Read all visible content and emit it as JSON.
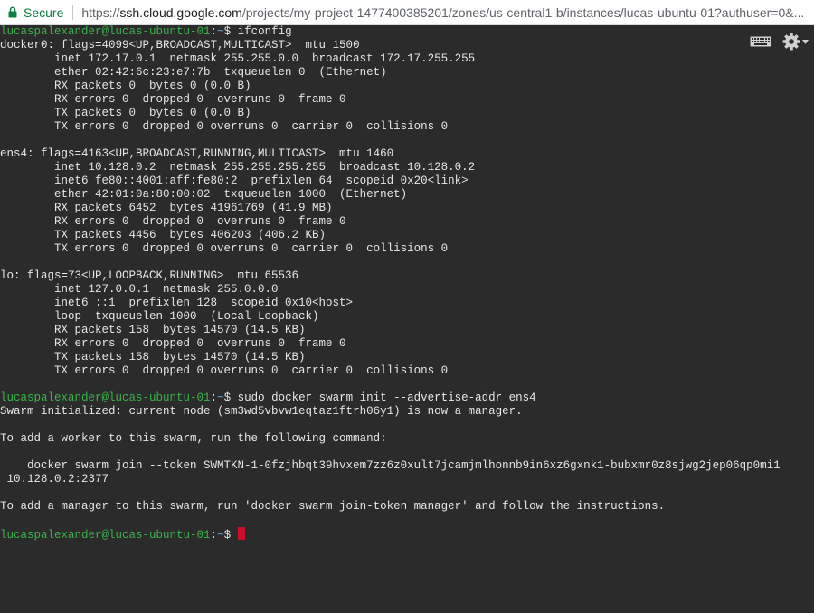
{
  "address_bar": {
    "secure_label": "Secure",
    "url_scheme": "https://",
    "url_host": "ssh.cloud.google.com",
    "url_path": "/projects/my-project-1477400385201/zones/us-central1-b/instances/lucas-ubuntu-01?authuser=0&..."
  },
  "terminal": {
    "prompt_user": "lucaspalexander@lucas-ubuntu-01",
    "prompt_sep": ":",
    "prompt_path": "~",
    "prompt_end": "$ ",
    "colors": {
      "background": "#2b2b2b",
      "text": "#e6e6e6",
      "prompt": "#3ab34a",
      "cursor": "#c8102e"
    },
    "icons": [
      "keyboard-icon",
      "gear-icon"
    ],
    "cmd1": "ifconfig",
    "cmd2": "sudo docker swarm init --advertise-addr ens4",
    "lines": [
      "docker0: flags=4099<UP,BROADCAST,MULTICAST>  mtu 1500",
      "        inet 172.17.0.1  netmask 255.255.0.0  broadcast 172.17.255.255",
      "        ether 02:42:6c:23:e7:7b  txqueuelen 0  (Ethernet)",
      "        RX packets 0  bytes 0 (0.0 B)",
      "        RX errors 0  dropped 0  overruns 0  frame 0",
      "        TX packets 0  bytes 0 (0.0 B)",
      "        TX errors 0  dropped 0 overruns 0  carrier 0  collisions 0",
      "",
      "ens4: flags=4163<UP,BROADCAST,RUNNING,MULTICAST>  mtu 1460",
      "        inet 10.128.0.2  netmask 255.255.255.255  broadcast 10.128.0.2",
      "        inet6 fe80::4001:aff:fe80:2  prefixlen 64  scopeid 0x20<link>",
      "        ether 42:01:0a:80:00:02  txqueuelen 1000  (Ethernet)",
      "        RX packets 6452  bytes 41961769 (41.9 MB)",
      "        RX errors 0  dropped 0  overruns 0  frame 0",
      "        TX packets 4456  bytes 406203 (406.2 KB)",
      "        TX errors 0  dropped 0 overruns 0  carrier 0  collisions 0",
      "",
      "lo: flags=73<UP,LOOPBACK,RUNNING>  mtu 65536",
      "        inet 127.0.0.1  netmask 255.0.0.0",
      "        inet6 ::1  prefixlen 128  scopeid 0x10<host>",
      "        loop  txqueuelen 1000  (Local Loopback)",
      "        RX packets 158  bytes 14570 (14.5 KB)",
      "        RX errors 0  dropped 0  overruns 0  frame 0",
      "        TX packets 158  bytes 14570 (14.5 KB)",
      "        TX errors 0  dropped 0 overruns 0  carrier 0  collisions 0",
      ""
    ],
    "output2": [
      "Swarm initialized: current node (sm3wd5vbvw1eqtaz1ftrh06y1) is now a manager.",
      "",
      "To add a worker to this swarm, run the following command:",
      "",
      "    docker swarm join --token SWMTKN-1-0fzjhbqt39hvxem7zz6z0xult7jcamjmlhonnb9in6xz6gxnk1-bubxmr0z8sjwg2jep06qp0mi1",
      " 10.128.0.2:2377",
      "",
      "To add a manager to this swarm, run 'docker swarm join-token manager' and follow the instructions.",
      ""
    ]
  }
}
